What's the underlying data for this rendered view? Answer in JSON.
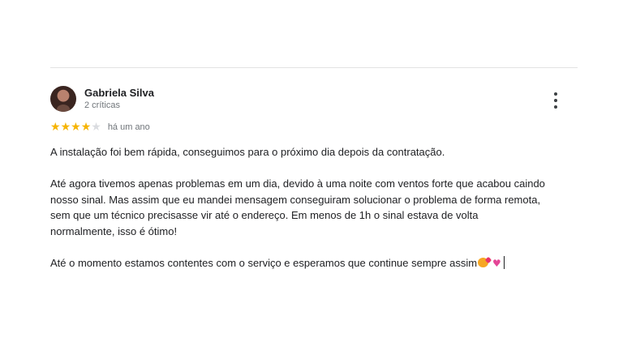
{
  "review": {
    "author": "Gabriela Silva",
    "author_meta": "2 críticas",
    "rating": 4,
    "rating_max": 5,
    "time_ago": "há um ano",
    "paragraphs": {
      "p1": "A instalação foi bem rápida, conseguimos para o próximo dia depois da contratação.",
      "p2": "Até agora tivemos apenas problemas em um dia, devido à uma noite com ventos forte que acabou caindo nosso sinal. Mas assim que eu mandei mensagem conseguiram solucionar o problema de forma remota, sem que um técnico precisasse vir até o endereço. Em menos de 1h o sinal estava de volta normalmente, isso é ótimo!",
      "p3": "Até o momento estamos contentes com o serviço e esperamos que continue sempre assim"
    },
    "icons": {
      "avatar": "avatar-photo",
      "menu": "more-vert-icon",
      "star": "star-icon",
      "emoji1": "smiling-face-with-hearts-emoji",
      "emoji2": "pink-heart-emoji"
    },
    "colors": {
      "star_on": "#f6b400",
      "star_off": "#dadce0",
      "heart": "#e44596"
    }
  }
}
